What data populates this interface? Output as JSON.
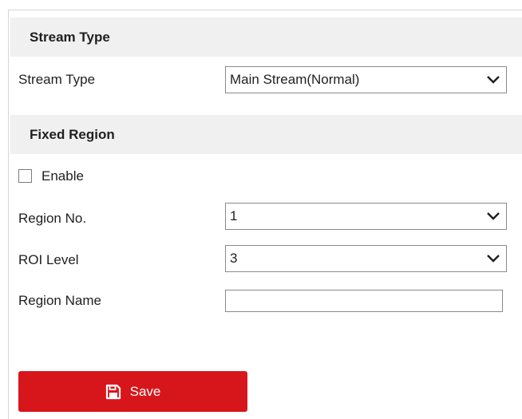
{
  "stream_type_section": {
    "title": "Stream Type",
    "label": "Stream Type",
    "selected": "Main Stream(Normal)"
  },
  "fixed_region_section": {
    "title": "Fixed Region",
    "enable_label": "Enable",
    "enable_checked": false,
    "region_no_label": "Region No.",
    "region_no_value": "1",
    "roi_level_label": "ROI Level",
    "roi_level_value": "3",
    "region_name_label": "Region Name",
    "region_name_value": ""
  },
  "save_button": {
    "label": "Save",
    "icon": "save-icon",
    "color": "#d7161b"
  }
}
